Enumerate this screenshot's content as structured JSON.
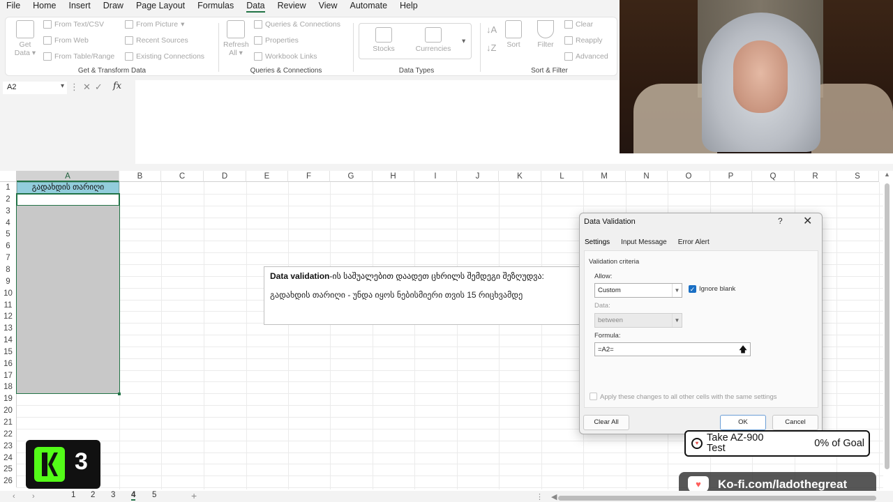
{
  "menu": [
    "File",
    "Home",
    "Insert",
    "Draw",
    "Page Layout",
    "Formulas",
    "Data",
    "Review",
    "View",
    "Automate",
    "Help"
  ],
  "ribbon": {
    "get_data": "Get Data",
    "from_text_csv": "From Text/CSV",
    "from_web": "From Web",
    "from_table_range": "From Table/Range",
    "from_picture": "From Picture",
    "recent_sources": "Recent Sources",
    "existing_connections": "Existing Connections",
    "group_get_transform": "Get & Transform Data",
    "refresh_all": "Refresh All",
    "queries_connections_btn": "Queries & Connections",
    "properties": "Properties",
    "workbook_links": "Workbook Links",
    "group_queries": "Queries & Connections",
    "stocks": "Stocks",
    "currencies": "Currencies",
    "group_data_types": "Data Types",
    "sort": "Sort",
    "filter": "Filter",
    "clear": "Clear",
    "reapply": "Reapply",
    "advanced": "Advanced",
    "group_sort_filter": "Sort & Filter"
  },
  "formula_bar": {
    "name_box": "A2",
    "fx": "fx",
    "formula": ""
  },
  "grid": {
    "columns": [
      "A",
      "B",
      "C",
      "D",
      "E",
      "F",
      "G",
      "H",
      "I",
      "J",
      "K",
      "L",
      "M",
      "N",
      "O",
      "P",
      "Q",
      "R",
      "S"
    ],
    "rows": [
      "1",
      "2",
      "3",
      "4",
      "5",
      "6",
      "7",
      "8",
      "9",
      "10",
      "11",
      "12",
      "13",
      "14",
      "15",
      "16",
      "17",
      "18",
      "19",
      "20",
      "21",
      "22",
      "23",
      "24",
      "25",
      "26"
    ],
    "a1_value": "გადახდის თარიღი"
  },
  "note": {
    "line1_bold": "Data validation",
    "line1_rest": "-ის საშუალებით დაადეთ ცხრილს შემდეგი შეზღუდვა:",
    "line2": "გადახდის თარიღი  - უნდა იყოს ნებისმიერი თვის 15 რიცხვამდე"
  },
  "dialog": {
    "title": "Data Validation",
    "help": "?",
    "close": "✕",
    "tabs": [
      "Settings",
      "Input Message",
      "Error Alert"
    ],
    "criteria_label": "Validation criteria",
    "allow_label": "Allow:",
    "allow_value": "Custom",
    "ignore_blank": "Ignore blank",
    "data_label": "Data:",
    "data_value": "between",
    "formula_label": "Formula:",
    "formula_value": "=A2=",
    "apply_all": "Apply these changes to all other cells with the same settings",
    "clear_all": "Clear All",
    "ok": "OK",
    "cancel": "Cancel"
  },
  "overlays": {
    "k3_num": "3",
    "goal_title": "Take AZ-900 Test",
    "goal_pct": "0% of Goal",
    "kofi": "Ko-fi.com/ladothegreat"
  },
  "sheets": [
    "1",
    "2",
    "3",
    "4",
    "5"
  ],
  "active_sheet": "4",
  "colors": {
    "accent": "#217346",
    "header_fill": "#92cddc",
    "selection_grey": "#c8c8c8"
  }
}
